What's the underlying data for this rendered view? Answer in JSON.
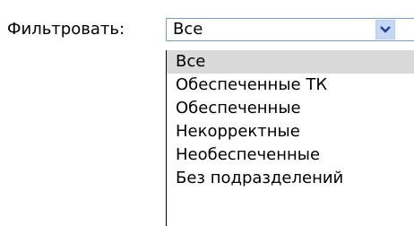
{
  "filter": {
    "label": "Фильтровать:",
    "selected_value": "Все",
    "arrow_icon": "chevron-down-icon",
    "options": [
      {
        "label": "Все",
        "selected": true
      },
      {
        "label": "Обеспеченные ТК",
        "selected": false
      },
      {
        "label": "Обеспеченные",
        "selected": false
      },
      {
        "label": "Некорректные",
        "selected": false
      },
      {
        "label": "Необеспеченные",
        "selected": false
      },
      {
        "label": "Без подразделений",
        "selected": false
      }
    ]
  },
  "colors": {
    "selected_option_bg": "#d9d9d9",
    "arrow_button_bg": "#c7d8f7",
    "select_border": "#7f9db9"
  }
}
